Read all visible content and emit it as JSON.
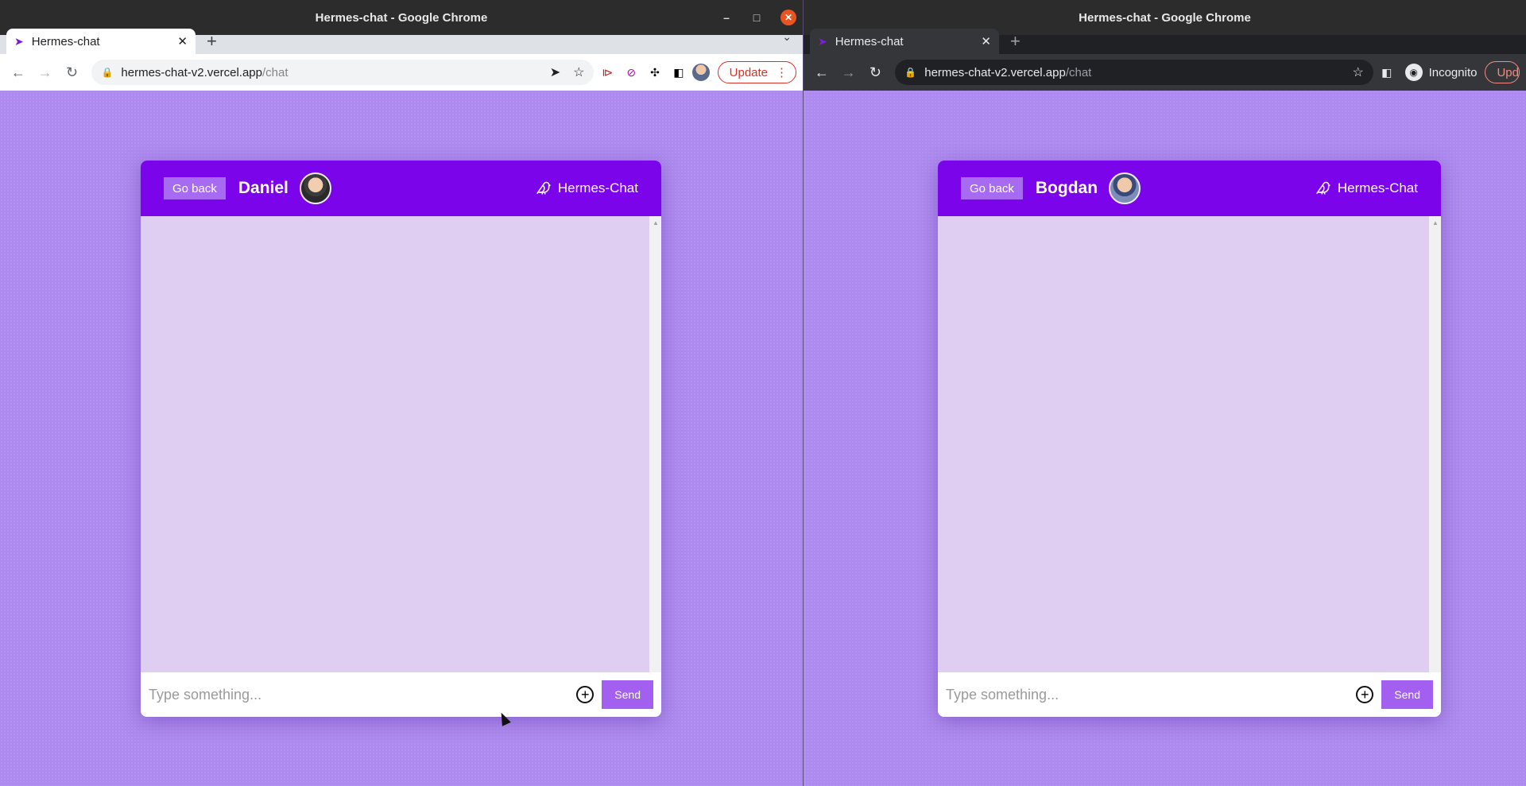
{
  "left": {
    "window_title": "Hermes-chat - Google Chrome",
    "tab_title": "Hermes-chat",
    "url_host": "hermes-chat-v2.vercel.app",
    "url_path": "/chat",
    "update_label": "Update",
    "chat": {
      "go_back": "Go back",
      "user_name": "Daniel",
      "brand": "Hermes-Chat",
      "placeholder": "Type something...",
      "send": "Send"
    }
  },
  "right": {
    "window_title": "Hermes-chat - Google Chrome",
    "tab_title": "Hermes-chat",
    "url_host": "hermes-chat-v2.vercel.app",
    "url_path": "/chat",
    "incognito_label": "Incognito",
    "update_label": "Upd",
    "chat": {
      "go_back": "Go back",
      "user_name": "Bogdan",
      "brand": "Hermes-Chat",
      "placeholder": "Type something...",
      "send": "Send"
    }
  },
  "icons": {
    "favicon": "hermes-bird-icon",
    "brand_icon": "bird-icon"
  },
  "colors": {
    "header": "#7b04ea",
    "page_bg": "#ad8aef",
    "messages_bg": "#dfcdf2",
    "send_button": "#a35ff0"
  }
}
